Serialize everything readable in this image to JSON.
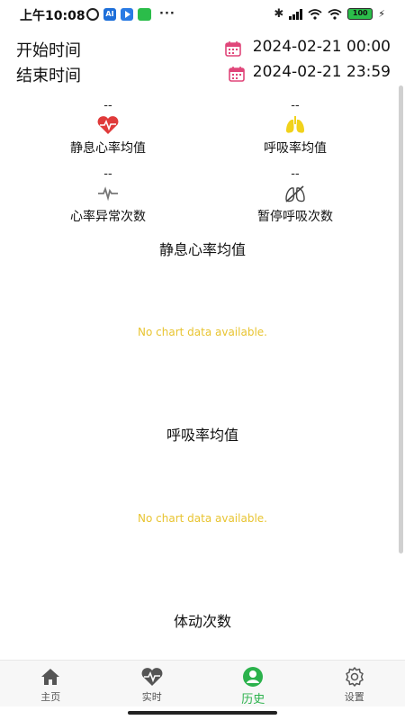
{
  "status_bar": {
    "time": "上午10:08",
    "ai_label": "AI",
    "more": "···",
    "battery": "100"
  },
  "range": {
    "start_label": "开始时间",
    "start_value": "2024-02-21 00:00",
    "end_label": "结束时间",
    "end_value": "2024-02-21 23:59"
  },
  "metrics": [
    {
      "value": "--",
      "label": "静息心率均值",
      "icon": "heart-rate-icon",
      "color": "#e03a3a"
    },
    {
      "value": "--",
      "label": "呼吸率均值",
      "icon": "lungs-icon",
      "color": "#f1d21b"
    },
    {
      "value": "--",
      "label": "心率异常次数",
      "icon": "heartbeat-wave-icon",
      "color": "#777777"
    },
    {
      "value": "--",
      "label": "暂停呼吸次数",
      "icon": "no-breath-icon",
      "color": "#444444"
    }
  ],
  "charts": [
    {
      "title": "静息心率均值",
      "empty_text": "No chart data available."
    },
    {
      "title": "呼吸率均值",
      "empty_text": "No chart data available."
    },
    {
      "title": "体动次数"
    }
  ],
  "nav": [
    {
      "label": "主页",
      "icon": "home-icon"
    },
    {
      "label": "实时",
      "icon": "heart-pulse-icon"
    },
    {
      "label": "历史",
      "icon": "user-history-icon",
      "active": true
    },
    {
      "label": "设置",
      "icon": "gear-icon"
    }
  ],
  "colors": {
    "accent": "#2bb24c",
    "calendar": "#e0467a",
    "empty_text": "#e8c431"
  }
}
